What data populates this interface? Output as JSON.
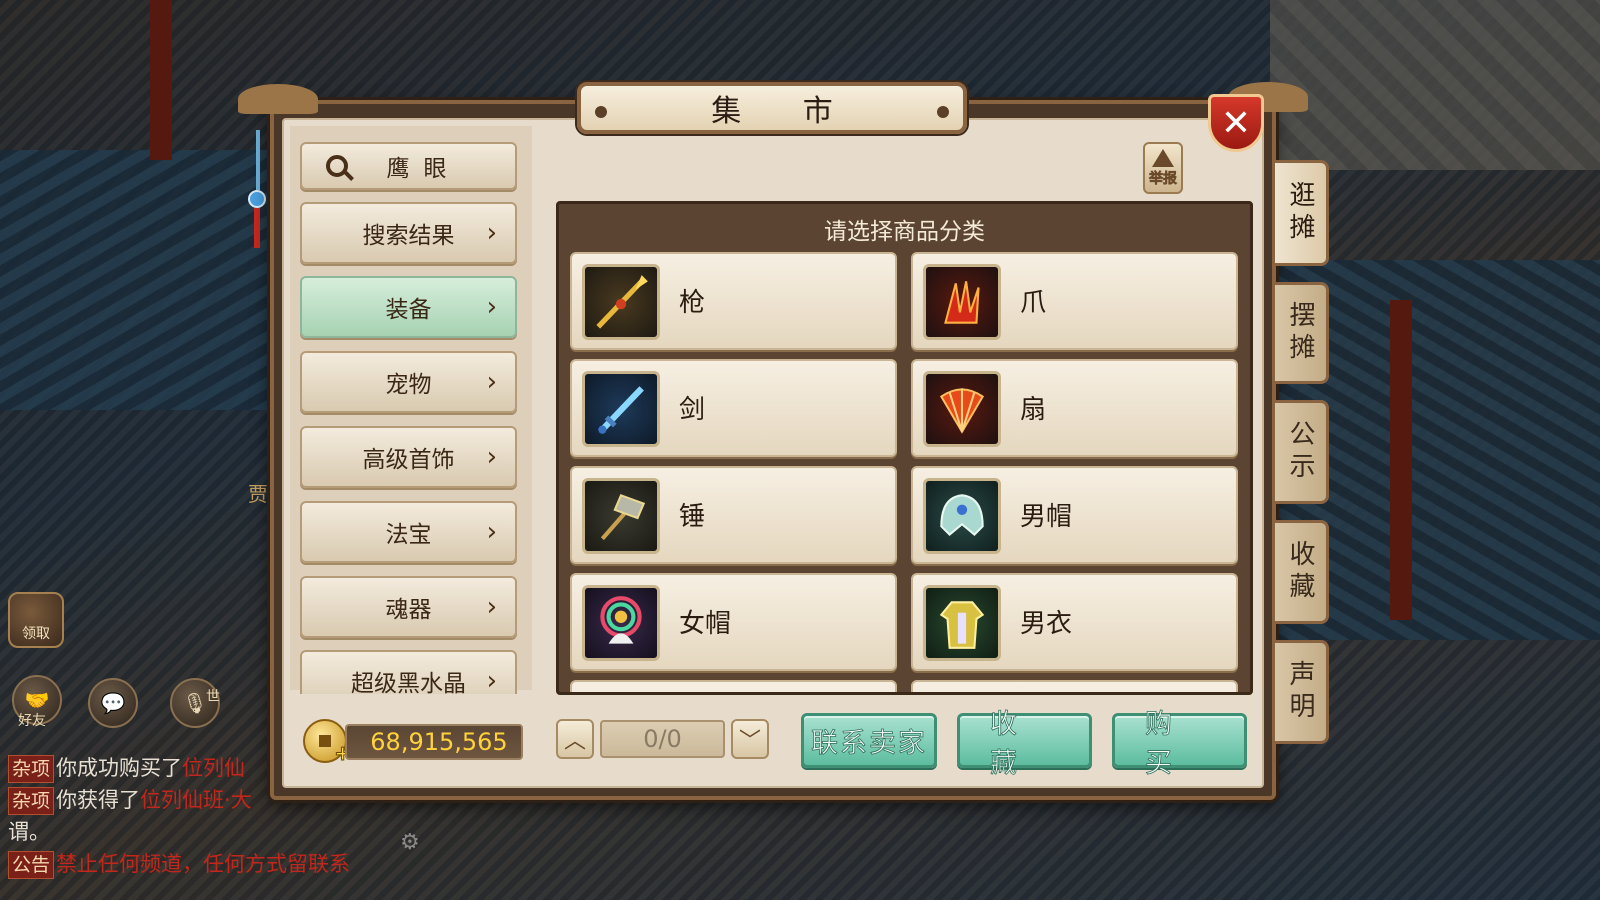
{
  "window": {
    "title": "集 市",
    "close_label": "✕"
  },
  "report": {
    "label": "举报"
  },
  "side_tabs": [
    {
      "label": "逛摊",
      "active": true
    },
    {
      "label": "摆摊",
      "active": false
    },
    {
      "label": "公示",
      "active": false
    },
    {
      "label": "收藏",
      "active": false
    },
    {
      "label": "声明",
      "active": false
    }
  ],
  "search": {
    "label": "鹰眼"
  },
  "menu": [
    {
      "label": "搜索结果",
      "active": false
    },
    {
      "label": "装备",
      "active": true
    },
    {
      "label": "宠物",
      "active": false
    },
    {
      "label": "高级首饰",
      "active": false
    },
    {
      "label": "法宝",
      "active": false
    },
    {
      "label": "魂器",
      "active": false
    },
    {
      "label": "超级黑水晶",
      "active": false
    }
  ],
  "categories": {
    "header": "请选择商品分类",
    "items": [
      {
        "label": "枪",
        "icon": "spear-icon"
      },
      {
        "label": "爪",
        "icon": "claw-icon"
      },
      {
        "label": "剑",
        "icon": "sword-icon"
      },
      {
        "label": "扇",
        "icon": "fan-icon"
      },
      {
        "label": "锤",
        "icon": "hammer-icon"
      },
      {
        "label": "男帽",
        "icon": "male-hat-icon"
      },
      {
        "label": "女帽",
        "icon": "female-hat-icon"
      },
      {
        "label": "男衣",
        "icon": "male-robe-icon"
      }
    ]
  },
  "currency": {
    "amount": "68,915,565"
  },
  "pager": {
    "text": "0/0"
  },
  "actions": {
    "contact": "联系卖家",
    "favorite": "收 藏",
    "buy": "购 买"
  },
  "hud": {
    "claim": "领取",
    "friends": "好友",
    "world_tag": "世",
    "side_text": "贾"
  },
  "chat": [
    {
      "tag": "杂项",
      "text": "你成功购买了",
      "highlight": "位列仙"
    },
    {
      "tag": "杂项",
      "text": "你获得了",
      "highlight": "位列仙班·大"
    },
    {
      "tag": "",
      "text": "谓。",
      "highlight": ""
    },
    {
      "tag": "公告",
      "text": "",
      "highlight": "禁止任何频道，任何方式留联系"
    }
  ],
  "colors": {
    "accent_green": "#5dbd9f",
    "gold": "#ffd23c",
    "panel_brown": "#4a3727",
    "close_red": "#c8281e"
  }
}
